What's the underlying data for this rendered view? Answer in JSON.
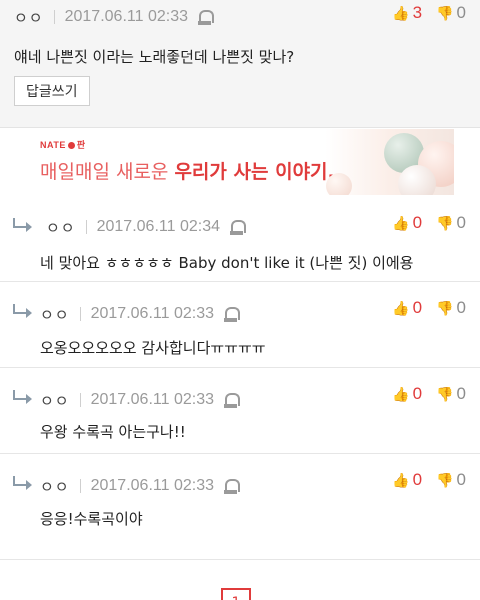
{
  "top_comment": {
    "author": "ㅇㅇ",
    "date": "2017.06.11 02:33",
    "up": "3",
    "down": "0",
    "text": "얘네 나쁜짓 이라는 노래좋던데 나쁜짓 맞나?",
    "reply_button": "답글쓰기"
  },
  "ad": {
    "logo_left": "NATE",
    "logo_right": "판",
    "text_normal": "매일매일 새로운 ",
    "text_bold": "우리가 사는 이야기."
  },
  "replies": [
    {
      "author": "ㅇㅇ",
      "date": "2017.06.11 02:34",
      "up": "0",
      "down": "0",
      "text": "네 맞아요 ㅎㅎㅎㅎㅎ Baby don't like it (나쁜 짓) 이에용"
    },
    {
      "author": "ㅇㅇ",
      "date": "2017.06.11 02:33",
      "up": "0",
      "down": "0",
      "text": "오옹오오오오오 감사합니다ㅠㅠㅠㅠ"
    },
    {
      "author": "ㅇㅇ",
      "date": "2017.06.11 02:33",
      "up": "0",
      "down": "0",
      "text": "우왕 수록곡 아는구나!!"
    },
    {
      "author": "ㅇㅇ",
      "date": "2017.06.11 02:33",
      "up": "0",
      "down": "0",
      "text": "응응!수록곡이야"
    }
  ],
  "pagination": {
    "current": "1"
  },
  "colors": {
    "accent": "#e03b3b",
    "muted": "#9a9a9a"
  }
}
